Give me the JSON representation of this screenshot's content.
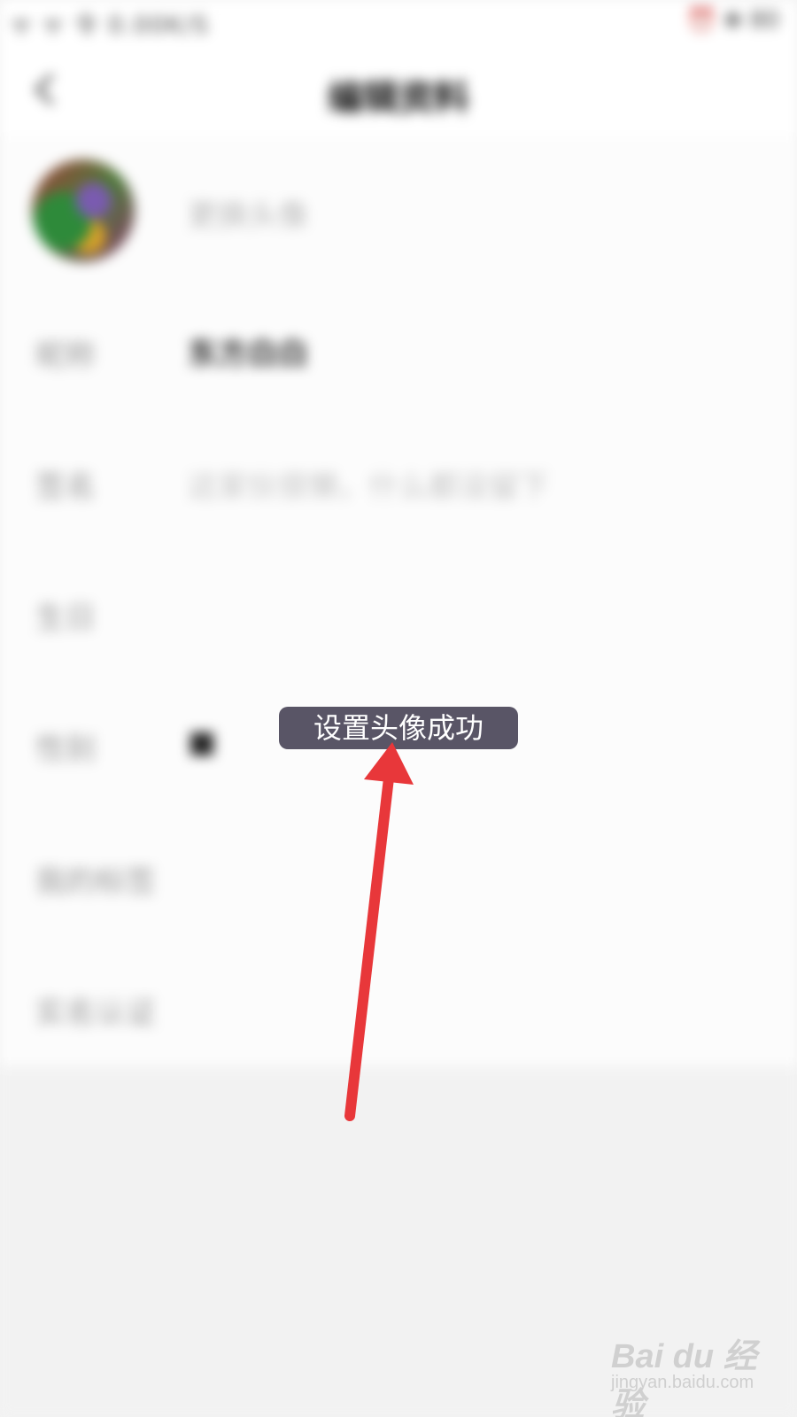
{
  "status_bar": {
    "left_text": "ᯤ ᯤ 令 0.00K/S",
    "right_text": "⏰ ❀ 80"
  },
  "nav": {
    "title": "编辑资料"
  },
  "rows": [
    {
      "label": "",
      "value": "更换头像"
    },
    {
      "label": "昵称",
      "value": "东方白白"
    },
    {
      "label": "签名",
      "value": "这家伙很懒，什么都没留下"
    },
    {
      "label": "生日",
      "value": ""
    },
    {
      "label": "性别",
      "value": "■"
    },
    {
      "label": "我的标签",
      "value": ""
    },
    {
      "label": "实名认证",
      "value": ""
    }
  ],
  "toast": {
    "text": "设置头像成功"
  },
  "annotation": {
    "arrow_color": "#e8373a"
  },
  "watermark": {
    "brand": "Bai du 经验",
    "sub": "jingyan.baidu.com"
  },
  "colors": {
    "toast_bg": "#595566",
    "arrow": "#e8373a",
    "background": "#f3f3f3"
  }
}
